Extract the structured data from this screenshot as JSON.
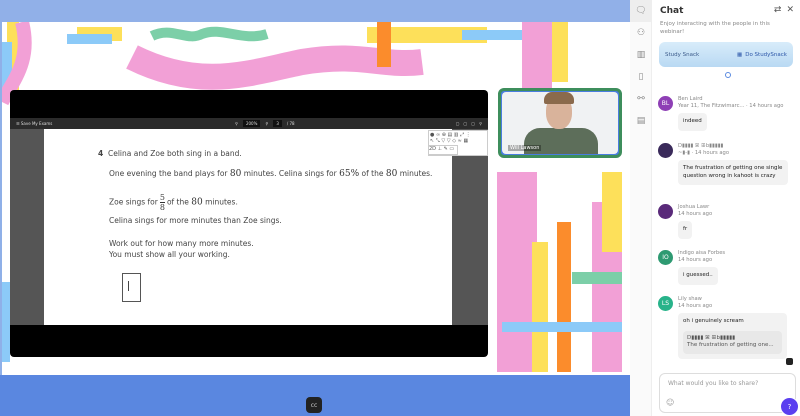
{
  "pdf": {
    "title": "Save My Exams",
    "zoom": "200%",
    "page": "3",
    "page_total": "/ 78"
  },
  "question": {
    "number": "4",
    "line1": "Celina and Zoe both sing in a band.",
    "line2a": "One evening the band plays for",
    "n80": "80",
    "line2b": "minutes. Celina sings for",
    "pct": "65%",
    "line2c": "of the",
    "line2d": "minutes.",
    "line3a": "Zoe sings for",
    "num": "5",
    "den": "8",
    "line3b": "of the",
    "line3c": "minutes.",
    "line4": "Celina sings for more minutes than Zoe sings.",
    "line5": "Work out for how many more minutes.",
    "line6": "You must show all your working."
  },
  "webcam": {
    "name": "Will Lawson"
  },
  "bottom": {
    "cc_label": "cc"
  },
  "chat": {
    "title": "Chat",
    "subtitle": "Enjoy interacting with the people in this webinar!",
    "snack_label": "Study Snack",
    "snack_button": "Do StudySnack",
    "messages": [
      {
        "initials": "BL",
        "name": "Ben Laird",
        "meta": "Year 11, The Fitzwimarc... · 14 hours ago",
        "text": "indeed",
        "color": "#8e3fb5"
      },
      {
        "initials": "",
        "name": "D▮▮▮▮ ꕤ ꕥb▮▮▮▮▮",
        "meta": "~▮-▮ · 14 hours ago",
        "text": "The frustration of getting one single question wrong in kahoot is crazy",
        "color": "#3a2a5a"
      },
      {
        "initials": "",
        "name": "Joshua Lawr",
        "meta": "14 hours ago",
        "text": "fr",
        "color": "#5a2a7a"
      },
      {
        "initials": "IO",
        "name": "Indigo aisa Forbes",
        "meta": "14 hours ago",
        "text": "i guessed..",
        "color": "#2e9a72"
      },
      {
        "initials": "LS",
        "name": "Lily shaw",
        "meta": "14 hours ago",
        "text": "oh i genuinely scream",
        "quote_name": "D▮▮▮▮ ꕤ ꕥb▮▮▮▮▮",
        "quote_text": "The frustration of getting one...",
        "color": "#28b38a"
      }
    ],
    "input_placeholder": "What would you like to share?",
    "help_label": "?"
  }
}
